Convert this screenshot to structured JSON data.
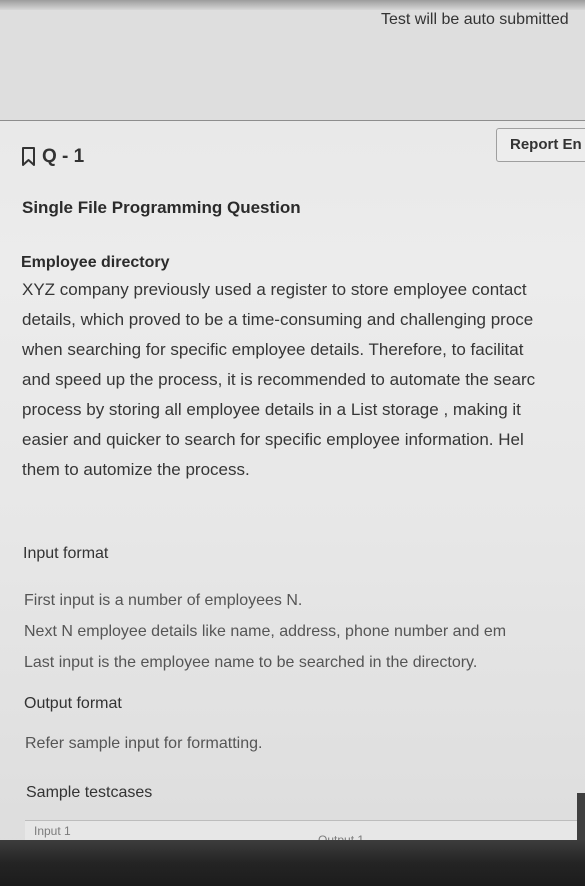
{
  "header": {
    "auto_submit_text": "Test will be auto submitted"
  },
  "toolbar": {
    "report_label": "Report En"
  },
  "question": {
    "number": "Q - 1",
    "type": "Single File Programming Question",
    "title": "Employee directory",
    "description": "XYZ company previously used a register to store employee contact\ndetails, which proved to be a time-consuming and challenging proce\nwhen searching for specific employee details. Therefore, to facilitat\nand speed up the process, it is recommended to automate the searc\nprocess by storing all employee details in a List storage , making it\neasier and quicker to search for specific employee information. Hel\nthem to automize the process."
  },
  "input_format": {
    "heading": "Input format",
    "lines": "First input is a number of employees N.\nNext N employee details like name, address, phone number and em\nLast input is the employee name to be searched in the directory."
  },
  "output_format": {
    "heading": "Output format",
    "description": "Refer sample input for formatting."
  },
  "sample": {
    "heading": "Sample testcases",
    "input_label": "Input 1",
    "output_label": "Output 1"
  }
}
